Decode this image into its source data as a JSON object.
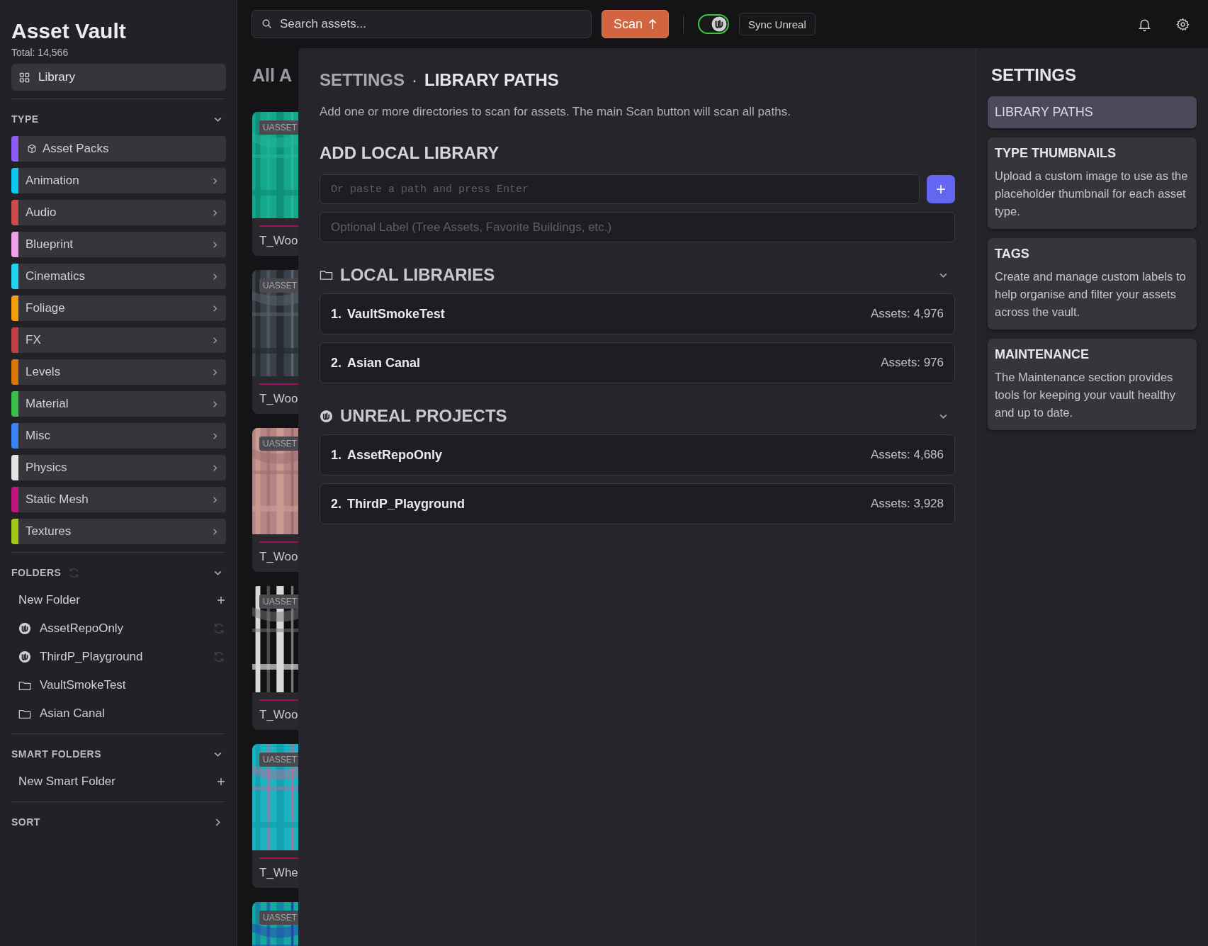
{
  "sidebar": {
    "title": "Asset Vault",
    "total": "Total: 14,566",
    "nav": [
      {
        "label": "Library",
        "selected": true
      }
    ],
    "type_section": {
      "heading": "TYPE",
      "expanded": true,
      "items": [
        {
          "label": "Asset Packs",
          "color": "#8b5cf6",
          "kind": "pack"
        },
        {
          "label": "Animation",
          "color": "#0ec8f0",
          "kind": "type"
        },
        {
          "label": "Audio",
          "color": "#c94c4c",
          "kind": "type"
        },
        {
          "label": "Blueprint",
          "color": "#f0a0e8",
          "kind": "type"
        },
        {
          "label": "Cinematics",
          "color": "#22d3ee",
          "kind": "type"
        },
        {
          "label": "Foliage",
          "color": "#f59e0b",
          "kind": "type"
        },
        {
          "label": "FX",
          "color": "#c0404a",
          "kind": "type"
        },
        {
          "label": "Levels",
          "color": "#d97706",
          "kind": "type"
        },
        {
          "label": "Material",
          "color": "#3bbf4b",
          "kind": "type"
        },
        {
          "label": "Misc",
          "color": "#3b82f6",
          "kind": "type"
        },
        {
          "label": "Physics",
          "color": "#e5e5e5",
          "kind": "type"
        },
        {
          "label": "Static Mesh",
          "color": "#c0147e",
          "kind": "type"
        },
        {
          "label": "Textures",
          "color": "#a3c817",
          "kind": "type"
        }
      ]
    },
    "folders": {
      "heading": "FOLDERS",
      "expanded": true,
      "items": [
        {
          "label": "New Folder",
          "kind": "new"
        },
        {
          "label": "AssetRepoOnly",
          "kind": "unreal"
        },
        {
          "label": "ThirdP_Playground",
          "kind": "unreal"
        },
        {
          "label": "VaultSmokeTest",
          "kind": "folder"
        },
        {
          "label": "Asian Canal",
          "kind": "folder"
        }
      ]
    },
    "smart_folders": {
      "heading": "SMART FOLDERS",
      "expanded": true,
      "items": [
        {
          "label": "New Smart Folder",
          "kind": "new"
        }
      ]
    },
    "sort": {
      "heading": "SORT",
      "expanded": false
    }
  },
  "topbar": {
    "search": {
      "placeholder": "Search assets..."
    },
    "scan_button": "Scan",
    "sync_toggle": {
      "on": true
    },
    "sync_button": "Sync Unreal"
  },
  "grid": {
    "heading": "All A",
    "cards": [
      {
        "badge": "UASSET",
        "name": "T_Woo"
      },
      {
        "badge": "UASSET",
        "name": "T_Woo"
      },
      {
        "badge": "UASSET",
        "name": "T_Woo"
      },
      {
        "badge": "UASSET",
        "name": "T_Woo"
      },
      {
        "badge": "UASSET",
        "name": "T_Whe"
      },
      {
        "badge": "UASSET"
      }
    ]
  },
  "settings": {
    "breadcrumb": {
      "parent": "SETTINGS",
      "separator": "·",
      "current": "LIBRARY PATHS"
    },
    "description": "Add one or more directories to scan for assets. The main Scan button will scan all paths.",
    "add_library": {
      "heading": "ADD LOCAL LIBRARY",
      "path_placeholder": "Or paste a path and press Enter",
      "add_button": "+",
      "label_placeholder": "Optional Label (Tree Assets, Favorite Buildings, etc.)"
    },
    "sections": [
      {
        "kind": "folder",
        "heading": "LOCAL LIBRARIES",
        "expanded": true,
        "rows": [
          {
            "index": "1.",
            "name": "VaultSmokeTest",
            "count": "Assets: 4,976"
          },
          {
            "index": "2.",
            "name": "Asian Canal",
            "count": "Assets: 976"
          }
        ]
      },
      {
        "kind": "unreal",
        "heading": "UNREAL PROJECTS",
        "expanded": true,
        "rows": [
          {
            "index": "1.",
            "name": "AssetRepoOnly",
            "count": "Assets: 4,686"
          },
          {
            "index": "2.",
            "name": "ThirdP_Playground",
            "count": "Assets: 3,928"
          }
        ]
      }
    ],
    "nav": {
      "heading": "SETTINGS",
      "items": [
        {
          "title": "LIBRARY PATHS",
          "selected": true
        },
        {
          "title": "TYPE THUMBNAILS",
          "description": "Upload a custom image to use as the placeholder thumbnail for each asset type.",
          "selected": false
        },
        {
          "title": "TAGS",
          "description": "Create and manage custom labels to help organise and filter your assets across the vault.",
          "selected": false
        },
        {
          "title": "MAINTENANCE",
          "description": "The Maintenance section provides tools for keeping your vault healthy and up to date.",
          "selected": false
        }
      ]
    }
  }
}
